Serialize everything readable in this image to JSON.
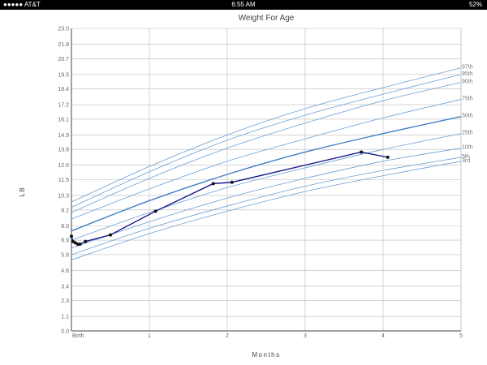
{
  "status_bar": {
    "carrier": "●●●●● AT&T",
    "time": "6:55 AM",
    "battery": "52%"
  },
  "chart_data": {
    "type": "line",
    "title": "Weight For Age",
    "xlabel": "Months",
    "ylabel": "LB",
    "xlim": [
      0,
      5
    ],
    "ylim": [
      0,
      23
    ],
    "x_ticks": [
      {
        "value": 0,
        "label": "Birth"
      },
      {
        "value": 1,
        "label": "1"
      },
      {
        "value": 2,
        "label": "2"
      },
      {
        "value": 3,
        "label": "3"
      },
      {
        "value": 4,
        "label": "4"
      },
      {
        "value": 5,
        "label": "5"
      }
    ],
    "y_ticks": [
      "0.0",
      "1.1",
      "2.3",
      "3.4",
      "4.6",
      "5.8",
      "6.9",
      "8.0",
      "9.2",
      "10.3",
      "11.5",
      "12.6",
      "13.8",
      "14.9",
      "16.1",
      "17.2",
      "18.4",
      "19.5",
      "20.7",
      "21.8",
      "23.0"
    ],
    "grid": true,
    "percentiles": [
      {
        "name": "97th",
        "values": [
          9.8,
          12.5,
          14.9,
          16.9,
          18.5,
          20.0
        ]
      },
      {
        "name": "95th",
        "values": [
          9.4,
          12.1,
          14.5,
          16.4,
          18.0,
          19.5
        ]
      },
      {
        "name": "90th",
        "values": [
          9.0,
          11.6,
          13.9,
          15.8,
          17.5,
          18.9
        ]
      },
      {
        "name": "75th",
        "values": [
          8.5,
          10.8,
          12.9,
          14.6,
          16.2,
          17.6
        ]
      },
      {
        "name": "50th",
        "values": [
          7.6,
          9.9,
          11.9,
          13.6,
          15.0,
          16.3
        ]
      },
      {
        "name": "25th",
        "values": [
          6.9,
          9.0,
          10.9,
          12.4,
          13.8,
          15.0
        ]
      },
      {
        "name": "10th",
        "values": [
          6.3,
          8.3,
          10.1,
          11.6,
          12.9,
          13.9
        ]
      },
      {
        "name": "5th",
        "values": [
          5.8,
          7.8,
          9.5,
          11.0,
          12.2,
          13.2
        ]
      },
      {
        "name": "3rd",
        "values": [
          5.4,
          7.4,
          9.1,
          10.6,
          11.8,
          12.9
        ]
      }
    ],
    "series": [
      {
        "x": [
          0.0,
          0.02,
          0.05,
          0.08,
          0.11,
          0.18,
          0.5,
          1.08,
          1.82,
          2.06,
          3.72,
          4.06
        ],
        "y": [
          7.2,
          6.8,
          6.7,
          6.6,
          6.6,
          6.8,
          7.3,
          9.1,
          11.2,
          11.3,
          13.6,
          13.2
        ]
      }
    ],
    "colors": {
      "percentile": "#6a9fd4",
      "median": "#3f7fc6",
      "measured": "#1a1a8c",
      "grid": "#bbbbbb",
      "axis": "#444444"
    }
  }
}
